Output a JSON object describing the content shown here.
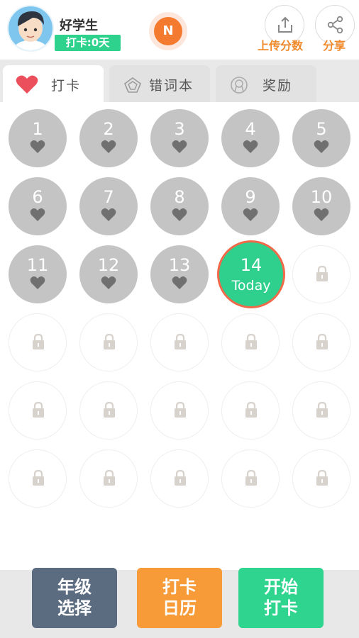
{
  "header": {
    "username": "好学生",
    "checkin_days": "打卡:0天",
    "badge_letter": "N",
    "upload_label": "上传分数",
    "share_label": "分享"
  },
  "tabs": [
    {
      "label": "打卡",
      "icon": "heart-icon"
    },
    {
      "label": "错词本",
      "icon": "polygon-icon"
    },
    {
      "label": "奖励",
      "icon": "award-icon"
    }
  ],
  "days": [
    {
      "num": "1"
    },
    {
      "num": "2"
    },
    {
      "num": "3"
    },
    {
      "num": "4"
    },
    {
      "num": "5"
    },
    {
      "num": "6"
    },
    {
      "num": "7"
    },
    {
      "num": "8"
    },
    {
      "num": "9"
    },
    {
      "num": "10"
    },
    {
      "num": "11"
    },
    {
      "num": "12"
    },
    {
      "num": "13"
    }
  ],
  "today": {
    "num": "14",
    "label": "Today"
  },
  "bottom": {
    "grade_line1": "年级",
    "grade_line2": "选择",
    "calendar_line1": "打卡",
    "calendar_line2": "日历",
    "start_line1": "开始",
    "start_line2": "打卡"
  },
  "colors": {
    "accent_green": "#2ed28c",
    "accent_orange": "#f08a2c",
    "grade_button": "#5c6c80",
    "calendar_button": "#f79a38",
    "start_button": "#2fd48e"
  }
}
